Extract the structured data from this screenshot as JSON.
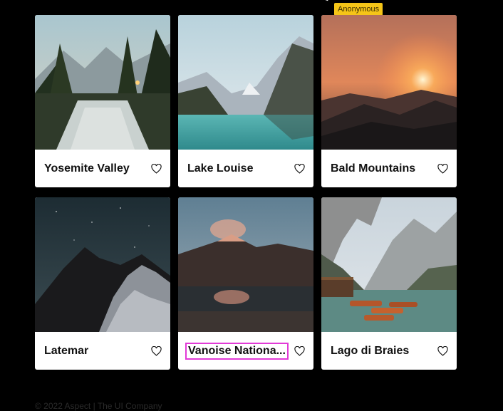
{
  "tooltip": {
    "label": "Anonymous"
  },
  "cards": [
    {
      "title": "Yosemite Valley",
      "image": "forest-river-photo",
      "favorite_icon": "heart-icon"
    },
    {
      "title": "Lake Louise",
      "image": "mountain-lake-photo",
      "favorite_icon": "heart-icon"
    },
    {
      "title": "Bald Mountains",
      "image": "sunset-mountains-photo",
      "favorite_icon": "heart-icon"
    },
    {
      "title": "Latemar",
      "image": "night-mountain-photo",
      "favorite_icon": "heart-icon"
    },
    {
      "title": "Vanoise Nationa...",
      "image": "mountain-reflection-photo",
      "favorite_icon": "heart-icon"
    },
    {
      "title": "Lago di Braies",
      "image": "lake-boats-photo",
      "favorite_icon": "heart-icon"
    }
  ],
  "footer": {
    "text": "© 2022 Aspect | The UI Company"
  },
  "colors": {
    "background": "#000000",
    "tooltip": "#f5c518",
    "focus_outline": "#e23ad7"
  }
}
